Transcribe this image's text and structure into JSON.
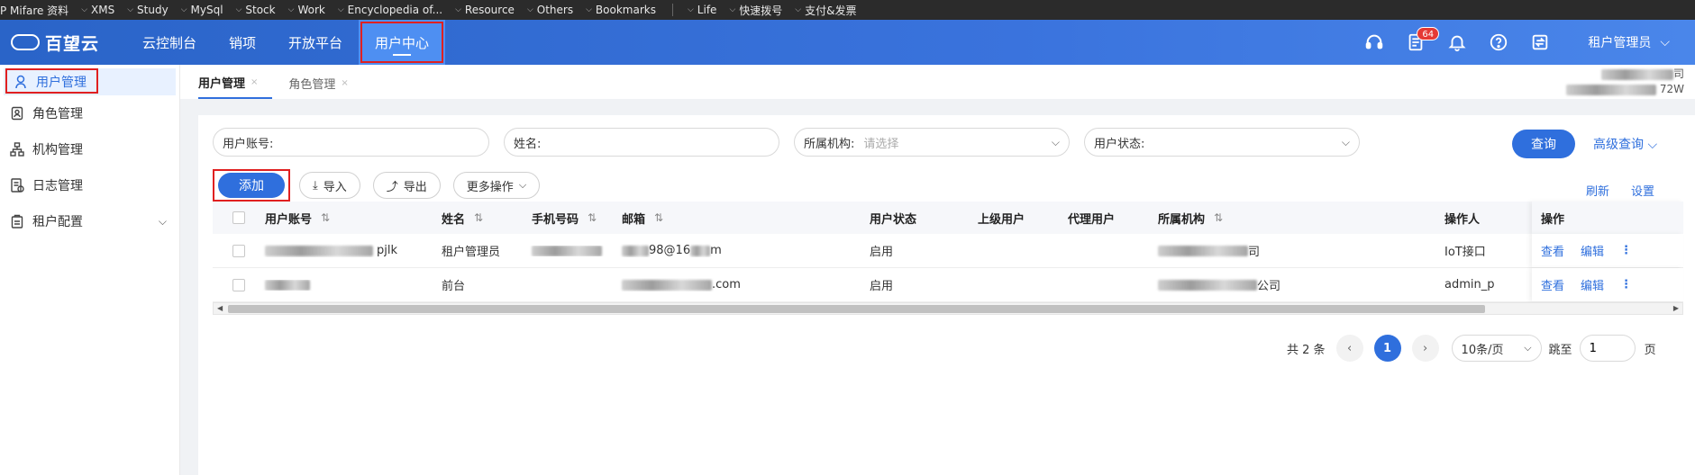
{
  "bookmarks": {
    "items": [
      "P Mifare 资料",
      "XMS",
      "Study",
      "MySql",
      "Stock",
      "Work",
      "Encyclopedia of...",
      "Resource",
      "Others",
      "Bookmarks"
    ],
    "extra": [
      "Life",
      "快速拨号",
      "支付&发票"
    ]
  },
  "header": {
    "logo_text": "百望云",
    "nav": [
      "云控制台",
      "销项",
      "开放平台",
      "用户中心"
    ],
    "active_nav": "用户中心",
    "notification_count": "64",
    "user_name": "租户管理员",
    "icons": [
      "headset-icon",
      "document-icon",
      "bell-icon",
      "help-icon",
      "switch-icon"
    ]
  },
  "sidebar": {
    "items": [
      {
        "label": "用户管理",
        "icon": "user-lock-icon"
      },
      {
        "label": "角色管理",
        "icon": "role-icon"
      },
      {
        "label": "机构管理",
        "icon": "org-icon"
      },
      {
        "label": "日志管理",
        "icon": "log-icon"
      },
      {
        "label": "租户配置",
        "icon": "config-icon"
      }
    ]
  },
  "tabs": [
    {
      "label": "用户管理",
      "close": "×"
    },
    {
      "label": "角色管理",
      "close": "×"
    }
  ],
  "corner": {
    "line1": "司",
    "line2": "72W"
  },
  "filters": {
    "account_label": "用户账号:",
    "name_label": "姓名:",
    "org_label": "所属机构:",
    "org_placeholder": "请选择",
    "status_label": "用户状态:",
    "query_button": "查询",
    "advanced_query": "高级查询"
  },
  "actions": {
    "add": "添加",
    "import": "导入",
    "export": "导出",
    "more": "更多操作",
    "refresh": "刷新",
    "settings": "设置"
  },
  "table": {
    "headers": [
      "用户账号",
      "姓名",
      "手机号码",
      "邮箱",
      "用户状态",
      "上级用户",
      "代理用户",
      "所属机构",
      "操作人",
      "操作"
    ],
    "rows": [
      {
        "account": "pjlk",
        "name": "租户管理员",
        "phone": "",
        "email": "98@16",
        "email_tail": "m",
        "status": "启用",
        "superior": "",
        "proxy": "",
        "org_tail": "司",
        "operator": "IoT接口",
        "view": "查看",
        "edit": "编辑"
      },
      {
        "account": "",
        "name": "前台",
        "phone": "",
        "email": "",
        "email_tail": ".com",
        "status": "启用",
        "superior": "",
        "proxy": "",
        "org_tail": "公司",
        "operator": "admin_p",
        "view": "查看",
        "edit": "编辑"
      }
    ]
  },
  "pagination": {
    "total": "共 2 条",
    "current_page": "1",
    "page_size": "10条/页",
    "goto_label": "跳至",
    "goto_value": "1",
    "page_suffix": "页"
  },
  "colors": {
    "primary": "#2f6fdd",
    "header_from": "#2a64c8",
    "header_to": "#4a86ea",
    "highlight_box": "#e02020"
  }
}
